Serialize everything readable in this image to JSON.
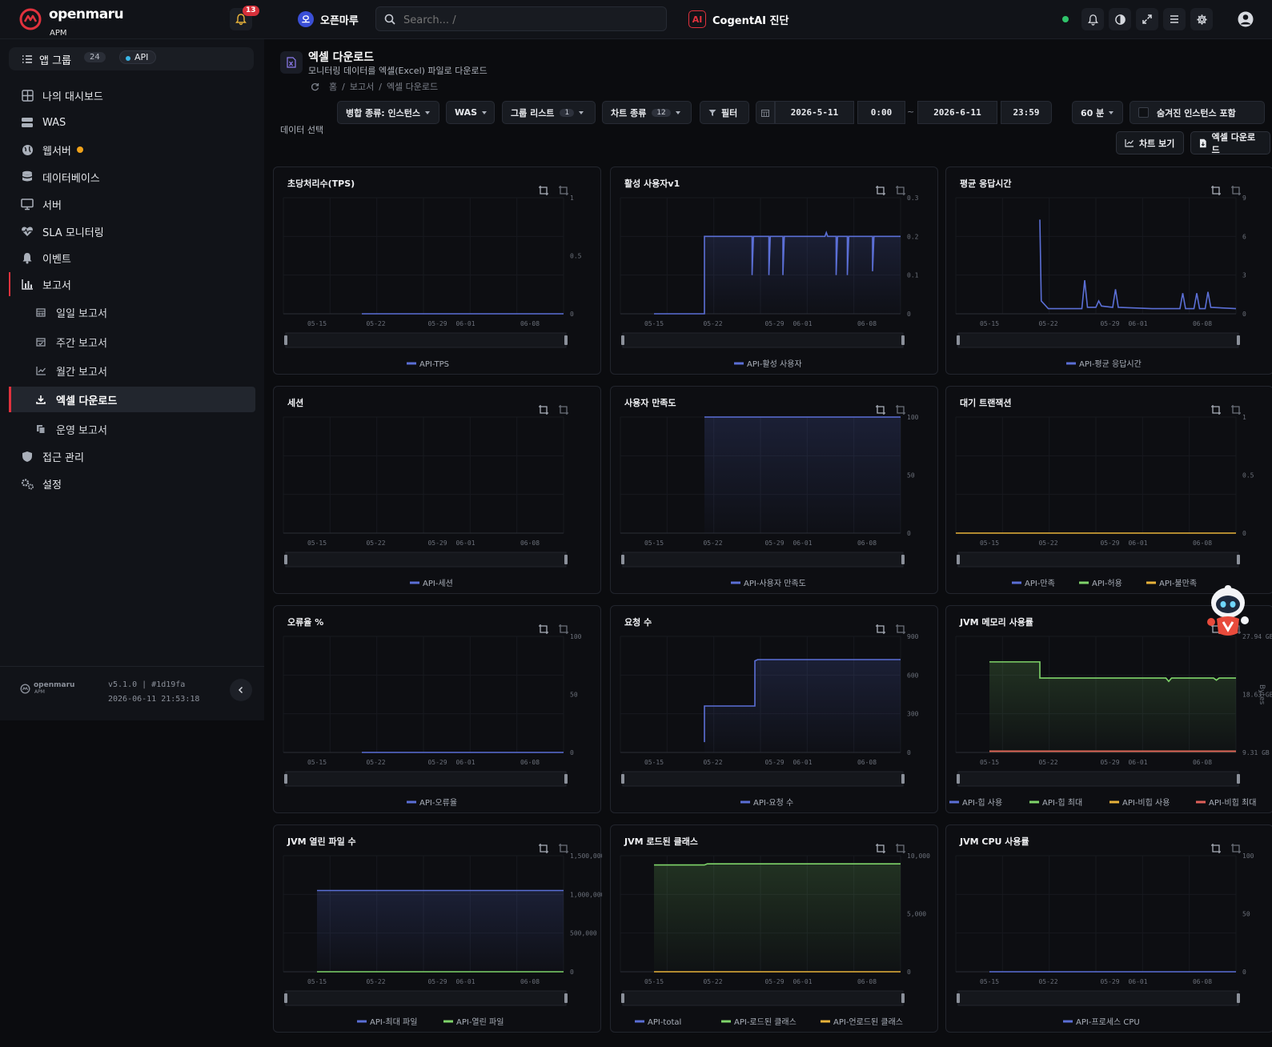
{
  "topbar": {
    "brand": "openmaru",
    "brand_sub": "APM",
    "notification_count": "13",
    "org_initial": "오",
    "org_name": "오픈마루",
    "search_placeholder": "Search... /",
    "ai_icon_text": "AI",
    "ai_label": "CogentAI 진단",
    "status_color": "#2fc36a"
  },
  "sidebar": {
    "app_group_label": "앱 그룹",
    "app_group_count": "24",
    "api_tag": "API",
    "items": [
      {
        "label": "나의 대시보드",
        "icon": "dashboard-icon"
      },
      {
        "label": "WAS",
        "icon": "server-stack-icon"
      },
      {
        "label": "웹서버",
        "icon": "globe-icon"
      },
      {
        "label": "데이터베이스",
        "icon": "database-icon"
      },
      {
        "label": "서버",
        "icon": "monitor-icon"
      },
      {
        "label": "SLA 모니터링",
        "icon": "heartbeat-icon"
      },
      {
        "label": "이벤트",
        "icon": "bell-icon"
      },
      {
        "label": "보고서",
        "icon": "chart-bar-icon"
      }
    ],
    "report_subitems": [
      {
        "label": "일일 보고서",
        "icon": "calendar-icon"
      },
      {
        "label": "주간 보고서",
        "icon": "calendar-check-icon"
      },
      {
        "label": "월간 보고서",
        "icon": "line-chart-icon"
      },
      {
        "label": "엑셀 다운로드",
        "icon": "download-icon"
      },
      {
        "label": "운영 보고서",
        "icon": "copy-icon"
      }
    ],
    "bottom_items": [
      {
        "label": "접근 관리",
        "icon": "shield-icon"
      },
      {
        "label": "설정",
        "icon": "gears-icon"
      }
    ],
    "footer_brand": "openmaru",
    "footer_brand_sub": "APM",
    "version": "v5.1.0 | #1d19fa",
    "build_time": "2026-06-11 21:53:18"
  },
  "page": {
    "title": "엑셀 다운로드",
    "description": "모니터링 데이터를 엑셀(Excel) 파일로 다운로드",
    "breadcrumb": [
      "홈",
      "보고서",
      "엑셀 다운로드"
    ],
    "data_select_label": "데이터 선택"
  },
  "controls": {
    "merge_type": "병합 종류: 인스턴스",
    "was": "WAS",
    "group_list": "그룹 리스트",
    "group_count": "1",
    "chart_type": "차트 종류",
    "chart_count": "12",
    "filter": "필터",
    "start_date": "2026-5-11",
    "start_time": "0:00",
    "range_sep": "~",
    "end_date": "2026-6-11",
    "end_time": "23:59",
    "interval": "60 분",
    "hidden_instances": "숨겨진 인스턴스 포함",
    "view_chart": "차트 보기",
    "excel_download": "엑셀 다운로드"
  },
  "chart_data": [
    {
      "title": "초당처리수(TPS)",
      "type": "line",
      "x_ticks": [
        "05-15",
        "05-22",
        "05-29",
        "06-01",
        "06-08"
      ],
      "y_ticks": [
        "1",
        "0.5",
        "0"
      ],
      "ylim": [
        0,
        1
      ],
      "series": [
        {
          "name": "API-TPS",
          "color": "#5b6fd6",
          "points": [
            [
              0.28,
              0
            ],
            [
              1,
              0
            ]
          ]
        }
      ]
    },
    {
      "title": "활성 사용자v1",
      "type": "area",
      "x_ticks": [
        "05-15",
        "05-22",
        "05-29",
        "06-01",
        "06-08"
      ],
      "y_ticks": [
        "0.3",
        "0.2",
        "0.1",
        "0"
      ],
      "ylim": [
        0,
        0.3
      ],
      "series": [
        {
          "name": "API-활성 사용자",
          "color": "#5b6fd6",
          "points": [
            [
              0.12,
              0
            ],
            [
              0.3,
              0
            ],
            [
              0.3,
              0.2
            ],
            [
              0.47,
              0.2
            ],
            [
              0.47,
              0.1
            ],
            [
              0.475,
              0.2
            ],
            [
              0.53,
              0.2
            ],
            [
              0.53,
              0.1
            ],
            [
              0.535,
              0.2
            ],
            [
              0.58,
              0.2
            ],
            [
              0.58,
              0.1
            ],
            [
              0.585,
              0.2
            ],
            [
              0.73,
              0.2
            ],
            [
              0.735,
              0.21
            ],
            [
              0.74,
              0.2
            ],
            [
              0.77,
              0.2
            ],
            [
              0.77,
              0.1
            ],
            [
              0.775,
              0.2
            ],
            [
              0.81,
              0.2
            ],
            [
              0.81,
              0.1
            ],
            [
              0.815,
              0.2
            ],
            [
              0.9,
              0.2
            ],
            [
              0.9,
              0.11
            ],
            [
              0.905,
              0.2
            ],
            [
              1,
              0.2
            ]
          ]
        }
      ]
    },
    {
      "title": "평균 응답시간",
      "type": "line",
      "x_ticks": [
        "05-15",
        "05-22",
        "05-29",
        "06-01",
        "06-08"
      ],
      "y_ticks": [
        "9",
        "6",
        "3",
        "0"
      ],
      "ylim": [
        0,
        9
      ],
      "series": [
        {
          "name": "API-평균 응답시간",
          "color": "#5b6fd6",
          "points": [
            [
              0.3,
              7.3
            ],
            [
              0.305,
              1.0
            ],
            [
              0.33,
              0.4
            ],
            [
              0.45,
              0.4
            ],
            [
              0.46,
              2.6
            ],
            [
              0.47,
              0.5
            ],
            [
              0.5,
              0.5
            ],
            [
              0.51,
              1.0
            ],
            [
              0.52,
              0.6
            ],
            [
              0.56,
              0.5
            ],
            [
              0.57,
              1.9
            ],
            [
              0.58,
              0.5
            ],
            [
              0.7,
              0.4
            ],
            [
              0.8,
              0.4
            ],
            [
              0.81,
              1.6
            ],
            [
              0.82,
              0.4
            ],
            [
              0.85,
              0.4
            ],
            [
              0.86,
              1.6
            ],
            [
              0.87,
              0.4
            ],
            [
              0.89,
              0.4
            ],
            [
              0.9,
              1.7
            ],
            [
              0.91,
              0.5
            ],
            [
              1,
              0.4
            ]
          ]
        }
      ]
    },
    {
      "title": "세션",
      "type": "line",
      "x_ticks": [
        "05-15",
        "05-22",
        "05-29",
        "06-01",
        "06-08"
      ],
      "y_ticks": [],
      "ylim": [
        0,
        1
      ],
      "series": [
        {
          "name": "API-세션",
          "color": "#5b6fd6",
          "points": []
        }
      ]
    },
    {
      "title": "사용자 만족도",
      "type": "area",
      "x_ticks": [
        "05-15",
        "05-22",
        "05-29",
        "06-01",
        "06-08"
      ],
      "y_ticks": [
        "100",
        "50",
        "0"
      ],
      "ylim": [
        0,
        100
      ],
      "series": [
        {
          "name": "API-사용자 만족도",
          "color": "#5b6fd6",
          "points": [
            [
              0.3,
              100
            ],
            [
              1,
              100
            ]
          ]
        }
      ]
    },
    {
      "title": "대기 트랜잭션",
      "type": "line",
      "x_ticks": [
        "05-15",
        "05-22",
        "05-29",
        "06-01",
        "06-08"
      ],
      "y_ticks": [
        "1",
        "0.5",
        "0"
      ],
      "ylim": [
        0,
        1
      ],
      "series": [
        {
          "name": "API-만족",
          "color": "#5b6fd6",
          "points": []
        },
        {
          "name": "API-허용",
          "color": "#7fd46a",
          "points": []
        },
        {
          "name": "API-불만족",
          "color": "#e8b23a",
          "points": [
            [
              0,
              0
            ],
            [
              1,
              0
            ]
          ]
        }
      ]
    },
    {
      "title": "오류율 %",
      "type": "line",
      "x_ticks": [
        "05-15",
        "05-22",
        "05-29",
        "06-01",
        "06-08"
      ],
      "y_ticks": [
        "100",
        "50",
        "0"
      ],
      "ylim": [
        0,
        100
      ],
      "series": [
        {
          "name": "API-오류율",
          "color": "#5b6fd6",
          "points": [
            [
              0.28,
              0
            ],
            [
              1,
              0
            ]
          ]
        }
      ]
    },
    {
      "title": "요청 수",
      "type": "area",
      "x_ticks": [
        "05-15",
        "05-22",
        "05-29",
        "06-01",
        "06-08"
      ],
      "y_ticks": [
        "900",
        "600",
        "300",
        "0"
      ],
      "ylim": [
        0,
        900
      ],
      "series": [
        {
          "name": "API-요청 수",
          "color": "#5b6fd6",
          "points": [
            [
              0.3,
              80
            ],
            [
              0.3,
              360
            ],
            [
              0.48,
              360
            ],
            [
              0.48,
              710
            ],
            [
              0.49,
              720
            ],
            [
              1,
              720
            ]
          ]
        }
      ]
    },
    {
      "title": "JVM 메모리 사용률",
      "type": "area",
      "x_ticks": [
        "05-15",
        "05-22",
        "05-29",
        "06-01",
        "06-08"
      ],
      "y_ticks": [
        "27.94 GB",
        "18.63 GB",
        "9.31 GB"
      ],
      "ylabel": "Bytes",
      "ylim": [
        0,
        27.94
      ],
      "series": [
        {
          "name": "API-힙 사용",
          "color": "#5b6fd6",
          "points": []
        },
        {
          "name": "API-힙 최대",
          "color": "#7fd46a",
          "points": [
            [
              0.12,
              21.8
            ],
            [
              0.3,
              21.8
            ],
            [
              0.3,
              17.9
            ],
            [
              0.75,
              17.9
            ],
            [
              0.76,
              17.1
            ],
            [
              0.77,
              17.9
            ],
            [
              0.92,
              17.9
            ],
            [
              0.93,
              17.4
            ],
            [
              0.94,
              17.9
            ],
            [
              1,
              17.9
            ]
          ]
        },
        {
          "name": "API-비힙 사용",
          "color": "#e8b23a",
          "points": [
            [
              0.12,
              0.3
            ],
            [
              1,
              0.3
            ]
          ]
        },
        {
          "name": "API-비힙 최대",
          "color": "#e0605a",
          "points": [
            [
              0.12,
              0.3
            ],
            [
              1,
              0.3
            ]
          ]
        }
      ]
    },
    {
      "title": "JVM 열린 파일 수",
      "type": "area",
      "x_ticks": [
        "05-15",
        "05-22",
        "05-29",
        "06-01",
        "06-08"
      ],
      "y_ticks": [
        "1,500,000",
        "1,000,000",
        "500,000",
        "0"
      ],
      "ylim": [
        0,
        1500000
      ],
      "series": [
        {
          "name": "API-최대 파일",
          "color": "#5b6fd6",
          "points": [
            [
              0.12,
              1050000
            ],
            [
              1,
              1050000
            ]
          ]
        },
        {
          "name": "API-열린 파일",
          "color": "#7fd46a",
          "points": [
            [
              0.12,
              0
            ],
            [
              1,
              0
            ]
          ]
        }
      ]
    },
    {
      "title": "JVM 로드된 클래스",
      "type": "area",
      "x_ticks": [
        "05-15",
        "05-22",
        "05-29",
        "06-01",
        "06-08"
      ],
      "y_ticks": [
        "10,000",
        "5,000",
        "0"
      ],
      "ylim": [
        0,
        10000
      ],
      "series": [
        {
          "name": "API-total",
          "color": "#5b6fd6",
          "points": []
        },
        {
          "name": "API-로드된 클래스",
          "color": "#7fd46a",
          "points": [
            [
              0.12,
              9200
            ],
            [
              0.3,
              9200
            ],
            [
              0.31,
              9300
            ],
            [
              1,
              9300
            ]
          ]
        },
        {
          "name": "API-언로드된 클래스",
          "color": "#e8b23a",
          "points": [
            [
              0.12,
              0
            ],
            [
              1,
              0
            ]
          ]
        }
      ]
    },
    {
      "title": "JVM CPU 사용률",
      "type": "line",
      "x_ticks": [
        "05-15",
        "05-22",
        "05-29",
        "06-01",
        "06-08"
      ],
      "y_ticks": [
        "100",
        "50",
        "0"
      ],
      "ylim": [
        0,
        100
      ],
      "series": [
        {
          "name": "API-프로세스 CPU",
          "color": "#5b6fd6",
          "points": [
            [
              0.12,
              0
            ],
            [
              1,
              0
            ]
          ]
        }
      ]
    }
  ]
}
